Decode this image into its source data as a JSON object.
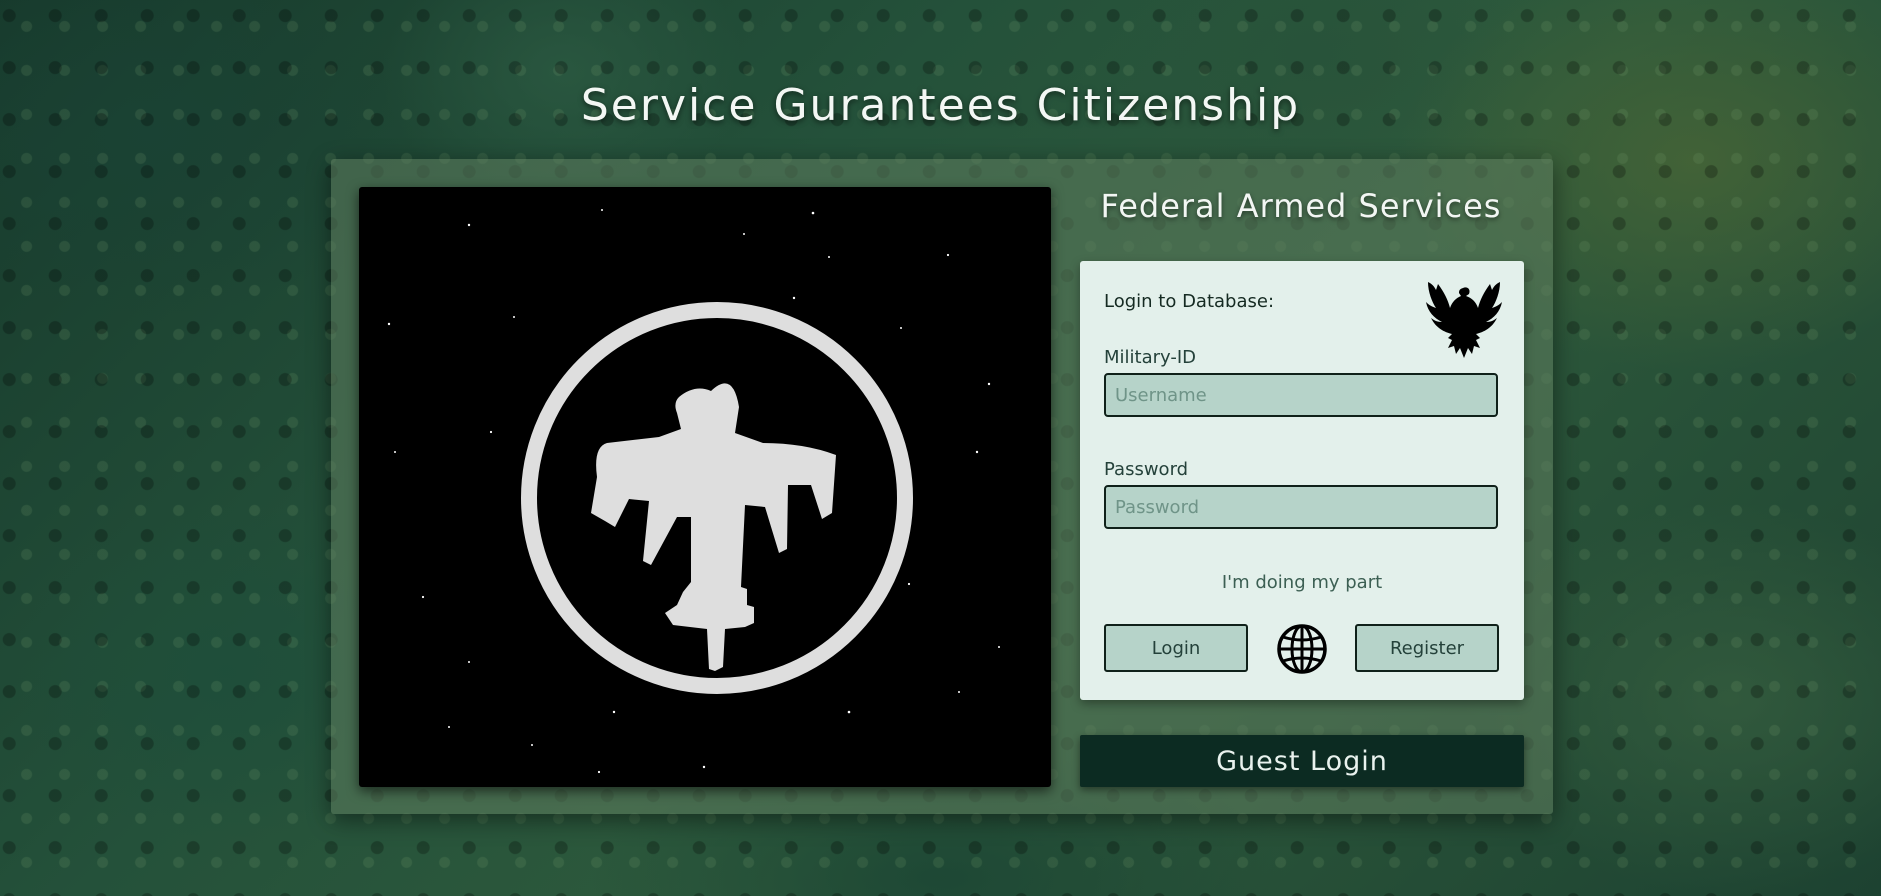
{
  "page": {
    "title": "Service Gurantees Citizenship"
  },
  "emblem": {
    "icon": "federation-eagle-emblem-icon"
  },
  "side": {
    "title": "Federal Armed Services"
  },
  "login": {
    "heading": "Login to Database:",
    "logo_icon": "eagle-icon",
    "military_id_label": "Military-ID",
    "username_placeholder": "Username",
    "username_value": "",
    "password_label": "Password",
    "password_placeholder": "Password",
    "password_value": "",
    "motto": "I'm doing my part",
    "login_button": "Login",
    "language_icon": "globe-icon",
    "register_button": "Register"
  },
  "guest": {
    "label": "Guest Login"
  },
  "colors": {
    "card": "#e3f0eb",
    "field": "#b6d3c9",
    "guest_button": "#0c2b22",
    "emblem": "#dcdcdc"
  }
}
